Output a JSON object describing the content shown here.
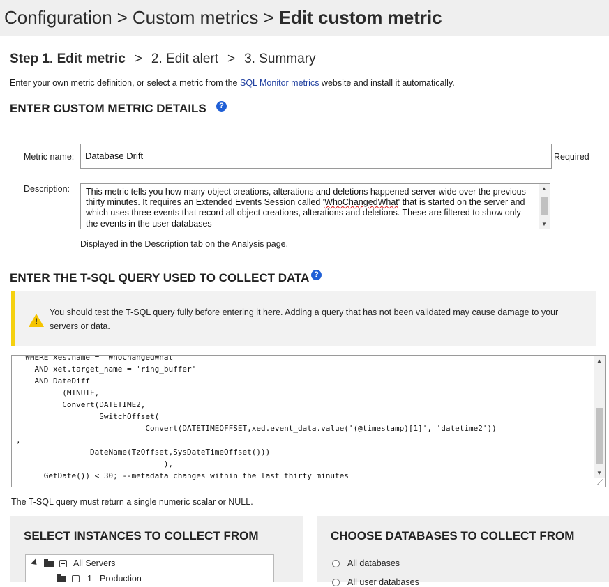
{
  "breadcrumb": {
    "part1": "Configuration",
    "sep": ">",
    "part2": "Custom metrics",
    "current": "Edit custom metric"
  },
  "steps": {
    "step1": "Step 1. Edit metric",
    "step2": "2. Edit alert",
    "step3": "3. Summary",
    "sep": ">"
  },
  "intro": {
    "before": "Enter your own metric definition, or select a metric from the ",
    "link": "SQL Monitor metrics",
    "after": " website and install it automatically."
  },
  "details": {
    "heading": "ENTER CUSTOM METRIC DETAILS",
    "help_icon": "question-mark",
    "metric_name_label": "Metric name:",
    "metric_name_value": "Database Drift",
    "required_label": "Required",
    "description_label": "Description:",
    "description_before": "This metric tells you how many object creations, alterations and deletions  happened server-wide over the previous thirty  minutes. It requires an Extended Events Session  called '",
    "description_misspelled": "WhoChangedWhat",
    "description_after": "' that is started on the server and  which uses three events that record all object  creations, alterations and deletions. These are filtered to show only the events in the user databases",
    "description_hint": "Displayed in the Description tab on the Analysis page."
  },
  "query": {
    "heading": "ENTER THE T-SQL QUERY USED TO COLLECT DATA",
    "warning_icon": "warning-triangle",
    "warning_text": "You should test the T-SQL query fully before entering it here. Adding a query that has not been validated may cause damage to your servers or data.",
    "code": "  WHERE xes.name = 'WhoChangedWhat'\n    AND xet.target_name = 'ring_buffer'\n    AND DateDiff\n          (MINUTE,\n          Convert(DATETIME2,\n                  SwitchOffset(\n                            Convert(DATETIMEOFFSET,xed.event_data.value('(@timestamp)[1]', 'datetime2'))\n,\n                DateName(TzOffset,SysDateTimeOffset()))\n                                ),\n      GetDate()) < 30; --metadata changes within the last thirty minutes",
    "hint": "The T-SQL query must return a single numeric scalar or NULL."
  },
  "instances": {
    "heading": "SELECT INSTANCES TO COLLECT FROM",
    "tree": [
      {
        "label": "All Servers"
      },
      {
        "label": "1 - Production"
      }
    ]
  },
  "databases": {
    "heading": "CHOOSE DATABASES TO COLLECT FROM",
    "options": [
      {
        "label": "All databases"
      },
      {
        "label": "All user databases"
      }
    ]
  },
  "colors": {
    "link": "#1f3f9f",
    "help_icon": "#1f5fd6",
    "warning_accent": "#f5d10f",
    "panel_bg": "#efefef"
  }
}
